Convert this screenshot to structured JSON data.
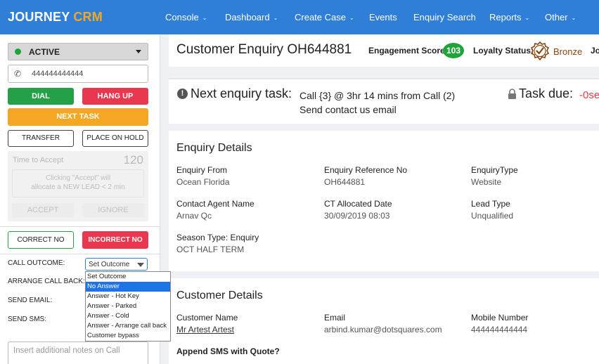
{
  "nav": {
    "brand_part1": "JOURNEY",
    "brand_part2": "CRM",
    "items": [
      {
        "label": "Console",
        "chevron": true
      },
      {
        "label": "Dashboard",
        "chevron": true
      },
      {
        "label": "Create Case",
        "chevron": true
      },
      {
        "label": "Events",
        "chevron": false
      },
      {
        "label": "Enquiry Search",
        "chevron": false
      },
      {
        "label": "Reports",
        "chevron": true
      },
      {
        "label": "Other",
        "chevron": true
      }
    ],
    "chevron_glyph": "❯"
  },
  "sidebar": {
    "status": "ACTIVE",
    "phone": "444444444444",
    "dial": "DIAL",
    "hang_up": "HANG UP",
    "next_task": "NEXT TASK",
    "transfer": "TRANSFER",
    "place_on_hold": "PLACE ON HOLD",
    "time_to_accept_label": "Time to Accept",
    "time_to_accept_value": "120",
    "accept_info_line1": "Clicking \"Accept\" will",
    "accept_info_line2": "allocate a NEW LEAD < 2 min",
    "accept": "ACCEPT",
    "ignore": "IGNORE",
    "correct_no": "CORRECT NO",
    "incorrect_no": "INCORRECT NO",
    "call_outcome_label": "CALL OUTCOME:",
    "arrange_call_back_label": "ARRANGE CALL BACK:",
    "send_email_label": "SEND EMAIL:",
    "send_sms_label": "SEND SMS:",
    "outcome_selected": "Set Outcome",
    "outcome_options": [
      "Set Outcome",
      "No Answer",
      "Answer - Hot Key",
      "Answer - Parked",
      "Answer - Cold",
      "Answer - Arrange call back",
      "Customer bypass"
    ],
    "outcome_highlighted_index": 1,
    "notes_placeholder": "Insert additional notes on Call"
  },
  "header": {
    "title": "Customer Enquiry OH644881",
    "engagement_label": "Engagement Score:",
    "engagement_score": "103",
    "loyalty_label": "Loyalty Status:",
    "loyalty_value": "Bronze",
    "cut_text": "Jo"
  },
  "task": {
    "heading": "Next enquiry task:",
    "line1": "Call {3} @ 3hr 14 mins from Call (2)",
    "line2": "Send contact us email",
    "due_label": "Task due:",
    "due_value": "-0se"
  },
  "enquiry": {
    "title": "Enquiry Details",
    "fields": [
      {
        "label": "Enquiry From",
        "value": "Ocean Florida"
      },
      {
        "label": "Enquiry Reference No",
        "value": "OH644881"
      },
      {
        "label": "EnquiryType",
        "value": "Website"
      },
      {
        "label": "Contact Agent Name",
        "value": "Arnav Qc"
      },
      {
        "label": "CT Allocated Date",
        "value": "30/09/2019 08:03"
      },
      {
        "label": "Lead Type",
        "value": "Unqualified"
      },
      {
        "label": "Season Type: Enquiry",
        "value": "OCT HALF TERM"
      }
    ]
  },
  "customer": {
    "title": "Customer Details",
    "fields": [
      {
        "label": "Customer Name",
        "value": "Mr Artest Artest"
      },
      {
        "label": "Email",
        "value": "arbind.kumar@dotsquares.com"
      },
      {
        "label": "Mobile Number",
        "value": "444444444444"
      }
    ],
    "append_sms_label": "Append SMS with Quote?"
  },
  "colors": {
    "nav_bg": "#2f7fd9",
    "brand_accent": "#f5a623",
    "green": "#24a148",
    "red": "#e8374e",
    "orange": "#f5a623",
    "bronze": "#8b4513"
  },
  "icons": {
    "phone": "☎",
    "task_alert": "!",
    "lock": "lock-icon",
    "medal": "bronze-medal-icon"
  }
}
